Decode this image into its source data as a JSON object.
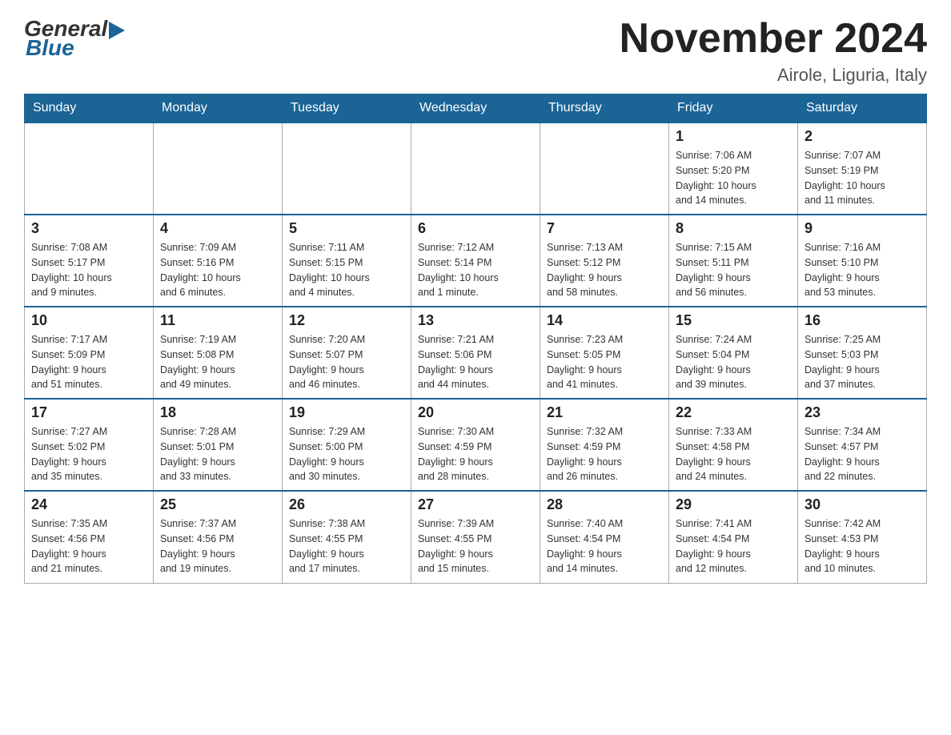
{
  "header": {
    "logo": {
      "general": "General",
      "blue": "Blue"
    },
    "title": "November 2024",
    "location": "Airole, Liguria, Italy"
  },
  "weekdays": [
    "Sunday",
    "Monday",
    "Tuesday",
    "Wednesday",
    "Thursday",
    "Friday",
    "Saturday"
  ],
  "weeks": [
    [
      {
        "day": "",
        "info": ""
      },
      {
        "day": "",
        "info": ""
      },
      {
        "day": "",
        "info": ""
      },
      {
        "day": "",
        "info": ""
      },
      {
        "day": "",
        "info": ""
      },
      {
        "day": "1",
        "info": "Sunrise: 7:06 AM\nSunset: 5:20 PM\nDaylight: 10 hours\nand 14 minutes."
      },
      {
        "day": "2",
        "info": "Sunrise: 7:07 AM\nSunset: 5:19 PM\nDaylight: 10 hours\nand 11 minutes."
      }
    ],
    [
      {
        "day": "3",
        "info": "Sunrise: 7:08 AM\nSunset: 5:17 PM\nDaylight: 10 hours\nand 9 minutes."
      },
      {
        "day": "4",
        "info": "Sunrise: 7:09 AM\nSunset: 5:16 PM\nDaylight: 10 hours\nand 6 minutes."
      },
      {
        "day": "5",
        "info": "Sunrise: 7:11 AM\nSunset: 5:15 PM\nDaylight: 10 hours\nand 4 minutes."
      },
      {
        "day": "6",
        "info": "Sunrise: 7:12 AM\nSunset: 5:14 PM\nDaylight: 10 hours\nand 1 minute."
      },
      {
        "day": "7",
        "info": "Sunrise: 7:13 AM\nSunset: 5:12 PM\nDaylight: 9 hours\nand 58 minutes."
      },
      {
        "day": "8",
        "info": "Sunrise: 7:15 AM\nSunset: 5:11 PM\nDaylight: 9 hours\nand 56 minutes."
      },
      {
        "day": "9",
        "info": "Sunrise: 7:16 AM\nSunset: 5:10 PM\nDaylight: 9 hours\nand 53 minutes."
      }
    ],
    [
      {
        "day": "10",
        "info": "Sunrise: 7:17 AM\nSunset: 5:09 PM\nDaylight: 9 hours\nand 51 minutes."
      },
      {
        "day": "11",
        "info": "Sunrise: 7:19 AM\nSunset: 5:08 PM\nDaylight: 9 hours\nand 49 minutes."
      },
      {
        "day": "12",
        "info": "Sunrise: 7:20 AM\nSunset: 5:07 PM\nDaylight: 9 hours\nand 46 minutes."
      },
      {
        "day": "13",
        "info": "Sunrise: 7:21 AM\nSunset: 5:06 PM\nDaylight: 9 hours\nand 44 minutes."
      },
      {
        "day": "14",
        "info": "Sunrise: 7:23 AM\nSunset: 5:05 PM\nDaylight: 9 hours\nand 41 minutes."
      },
      {
        "day": "15",
        "info": "Sunrise: 7:24 AM\nSunset: 5:04 PM\nDaylight: 9 hours\nand 39 minutes."
      },
      {
        "day": "16",
        "info": "Sunrise: 7:25 AM\nSunset: 5:03 PM\nDaylight: 9 hours\nand 37 minutes."
      }
    ],
    [
      {
        "day": "17",
        "info": "Sunrise: 7:27 AM\nSunset: 5:02 PM\nDaylight: 9 hours\nand 35 minutes."
      },
      {
        "day": "18",
        "info": "Sunrise: 7:28 AM\nSunset: 5:01 PM\nDaylight: 9 hours\nand 33 minutes."
      },
      {
        "day": "19",
        "info": "Sunrise: 7:29 AM\nSunset: 5:00 PM\nDaylight: 9 hours\nand 30 minutes."
      },
      {
        "day": "20",
        "info": "Sunrise: 7:30 AM\nSunset: 4:59 PM\nDaylight: 9 hours\nand 28 minutes."
      },
      {
        "day": "21",
        "info": "Sunrise: 7:32 AM\nSunset: 4:59 PM\nDaylight: 9 hours\nand 26 minutes."
      },
      {
        "day": "22",
        "info": "Sunrise: 7:33 AM\nSunset: 4:58 PM\nDaylight: 9 hours\nand 24 minutes."
      },
      {
        "day": "23",
        "info": "Sunrise: 7:34 AM\nSunset: 4:57 PM\nDaylight: 9 hours\nand 22 minutes."
      }
    ],
    [
      {
        "day": "24",
        "info": "Sunrise: 7:35 AM\nSunset: 4:56 PM\nDaylight: 9 hours\nand 21 minutes."
      },
      {
        "day": "25",
        "info": "Sunrise: 7:37 AM\nSunset: 4:56 PM\nDaylight: 9 hours\nand 19 minutes."
      },
      {
        "day": "26",
        "info": "Sunrise: 7:38 AM\nSunset: 4:55 PM\nDaylight: 9 hours\nand 17 minutes."
      },
      {
        "day": "27",
        "info": "Sunrise: 7:39 AM\nSunset: 4:55 PM\nDaylight: 9 hours\nand 15 minutes."
      },
      {
        "day": "28",
        "info": "Sunrise: 7:40 AM\nSunset: 4:54 PM\nDaylight: 9 hours\nand 14 minutes."
      },
      {
        "day": "29",
        "info": "Sunrise: 7:41 AM\nSunset: 4:54 PM\nDaylight: 9 hours\nand 12 minutes."
      },
      {
        "day": "30",
        "info": "Sunrise: 7:42 AM\nSunset: 4:53 PM\nDaylight: 9 hours\nand 10 minutes."
      }
    ]
  ]
}
